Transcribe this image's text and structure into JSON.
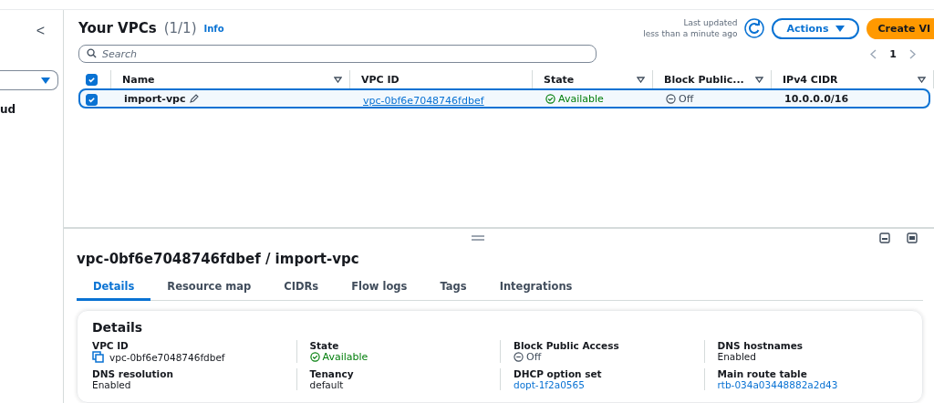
{
  "sidebar": {
    "collapse_label": "<",
    "partial_text": "ud"
  },
  "vpcs": {
    "title": "Your VPCs",
    "count": "(1/1)",
    "info": "Info",
    "last_updated": [
      "Last updated",
      "less than a minute ago"
    ],
    "actions": "Actions",
    "create": "Create VI",
    "search": {
      "placeholder": "Search"
    },
    "page": "1",
    "columns": [
      {
        "label": "Name"
      },
      {
        "label": "VPC ID"
      },
      {
        "label": "State"
      },
      {
        "label": "Block Public..."
      },
      {
        "label": "IPv4 CIDR"
      }
    ],
    "all_checked": true,
    "rows": [
      {
        "selected": true,
        "checked": true,
        "name": "import-vpc",
        "vpc_id": "vpc-0bf6e7048746fdbef",
        "state": "Available",
        "block_public": "Off",
        "cidr": "10.0.0.0/16"
      }
    ]
  },
  "detail": {
    "title": "vpc-0bf6e7048746fdbef / import-vpc",
    "tabs": [
      {
        "label": "Details",
        "selected": true
      },
      {
        "label": "Resource map",
        "selected": false
      },
      {
        "label": "CIDRs",
        "selected": false
      },
      {
        "label": "Flow logs",
        "selected": false
      },
      {
        "label": "Tags",
        "selected": false
      },
      {
        "label": "Integrations",
        "selected": false
      }
    ],
    "card_title": "Details",
    "fields": [
      {
        "label": "VPC ID",
        "value": "vpc-0bf6e7048746fdbef",
        "kind": "copy"
      },
      {
        "label": "State",
        "value": "Available",
        "kind": "status"
      },
      {
        "label": "Block Public Access",
        "value": "Off",
        "kind": "off"
      },
      {
        "label": "DNS hostnames",
        "value": "Enabled",
        "kind": "plain"
      },
      {
        "label": "DNS resolution",
        "value": "Enabled",
        "kind": "plain"
      },
      {
        "label": "Tenancy",
        "value": "default",
        "kind": "plain"
      },
      {
        "label": "DHCP option set",
        "value": "dopt-1f2a0565",
        "kind": "link"
      },
      {
        "label": "Main route table",
        "value": "rtb-034a03448882a2d43",
        "kind": "link"
      }
    ]
  }
}
